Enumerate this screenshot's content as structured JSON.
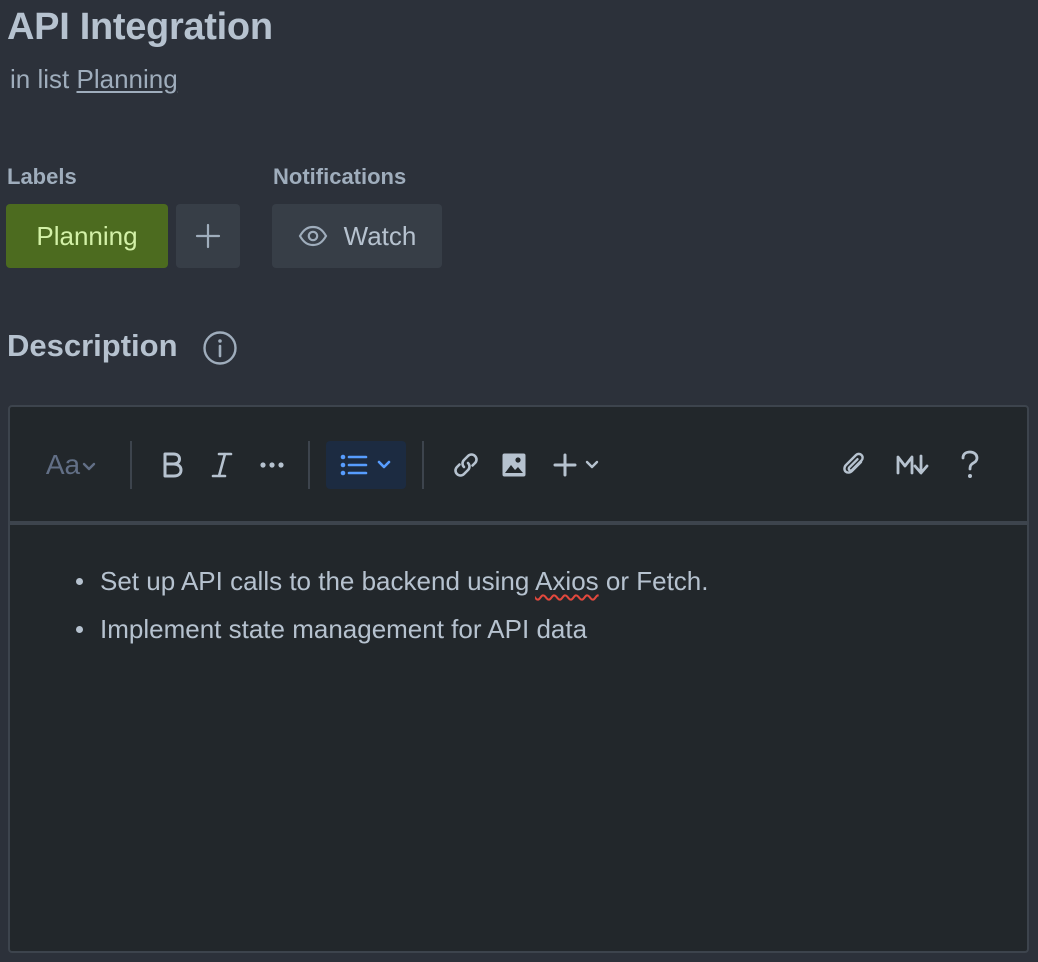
{
  "card": {
    "title": "API Integration",
    "list_prefix": "in list",
    "list_name": "Planning"
  },
  "labels_section": {
    "heading": "Labels",
    "label_chip": "Planning"
  },
  "notifications_section": {
    "heading": "Notifications",
    "watch_label": "Watch"
  },
  "description": {
    "heading": "Description",
    "toolbar": {
      "text_style": "Aa",
      "icons": [
        "text-style-icon",
        "bold-icon",
        "italic-icon",
        "more-formatting-icon",
        "bullet-list-icon",
        "link-icon",
        "image-icon",
        "insert-plus-icon",
        "attachment-icon",
        "markdown-icon",
        "help-icon"
      ]
    },
    "bullets": [
      {
        "before": "Set up API calls to the backend using ",
        "misspelled": "Axios",
        "after": " or Fetch."
      },
      {
        "text": "Implement state management for API data"
      }
    ]
  },
  "colors": {
    "background": "#2c313a",
    "label_green": "#4c6b1f",
    "label_text": "#d3f1a7",
    "active_button_bg": "#1c2b41",
    "accent_blue": "#579dff"
  }
}
